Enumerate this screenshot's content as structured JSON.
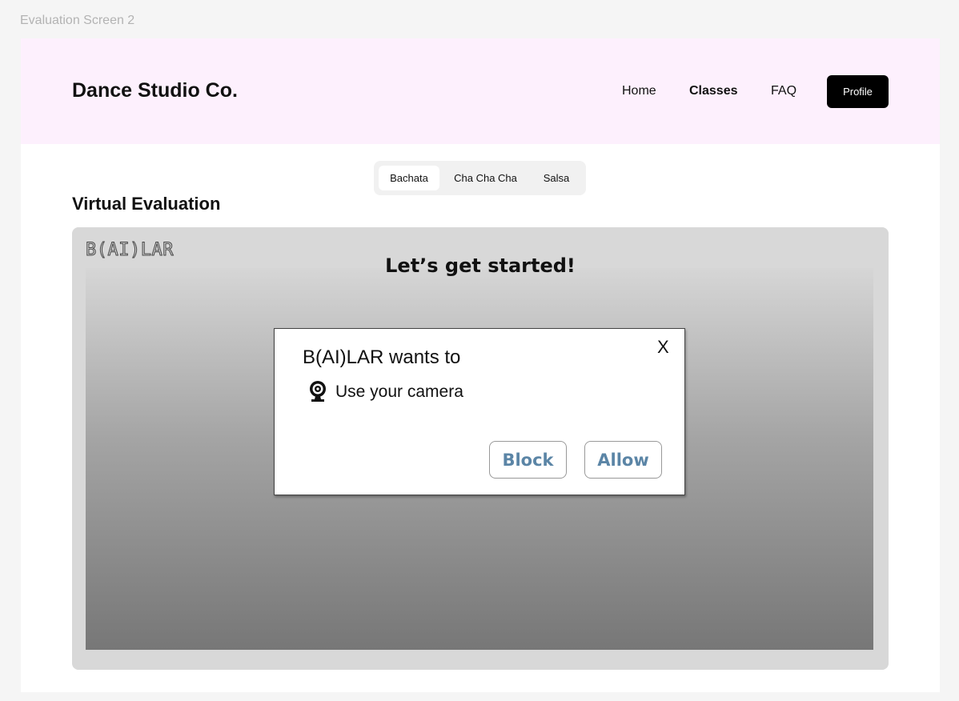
{
  "frame": {
    "label": "Evaluation Screen 2"
  },
  "header": {
    "brand": "Dance Studio Co.",
    "nav": [
      {
        "label": "Home",
        "active": false
      },
      {
        "label": "Classes",
        "active": true
      },
      {
        "label": "FAQ",
        "active": false
      }
    ],
    "profile_label": "Profile"
  },
  "tabs": [
    {
      "label": "Bachata",
      "selected": true
    },
    {
      "label": "Cha Cha Cha",
      "selected": false
    },
    {
      "label": "Salsa",
      "selected": false
    }
  ],
  "section": {
    "title": "Virtual Evaluation"
  },
  "panel": {
    "logo": "B(AI)LAR",
    "headline": "Let’s get started!"
  },
  "dialog": {
    "title": "B(AI)LAR wants to",
    "close_label": "X",
    "permission": {
      "icon": "webcam-icon",
      "text": "Use your camera"
    },
    "block_label": "Block",
    "allow_label": "Allow"
  },
  "colors": {
    "header_bg": "#fdf0fd",
    "dialog_button_text": "#5b85a6",
    "profile_button_bg": "#000000"
  }
}
